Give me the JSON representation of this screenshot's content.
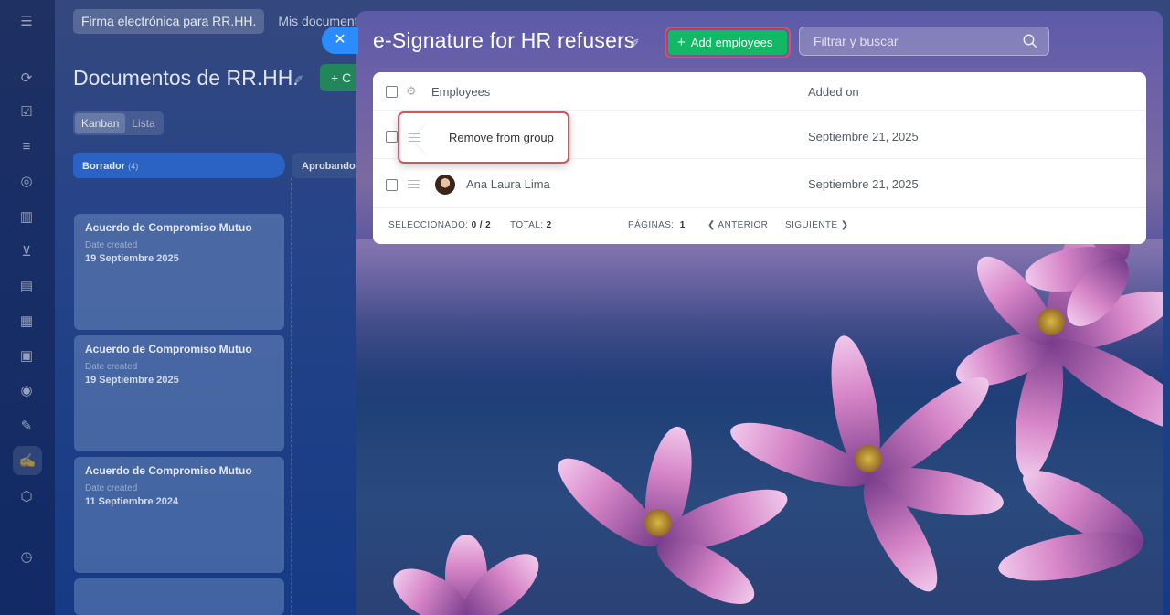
{
  "background": {
    "tabs": [
      "Firma electrónica para RR.HH.",
      "Mis documento"
    ],
    "title": "Documentos de RR.HH.",
    "create_label": "+ C",
    "view_tabs": [
      "Kanban",
      "Lista"
    ],
    "columns": [
      {
        "name": "Borrador",
        "count": "(4)"
      },
      {
        "name": "Aprobando"
      }
    ],
    "cards": [
      {
        "title": "Acuerdo de Compromiso Mutuo",
        "date_label": "Date created",
        "date": "19 Septiembre 2025"
      },
      {
        "title": "Acuerdo de Compromiso Mutuo",
        "date_label": "Date created",
        "date": "19 Septiembre 2025"
      },
      {
        "title": "Acuerdo de Compromiso Mutuo",
        "date_label": "Date created",
        "date": "11 Septiembre 2024"
      }
    ]
  },
  "panel": {
    "close_glyph": "✕",
    "title": "e-Signature for HR refusers",
    "add_button": "Add employees",
    "search_placeholder": "Filtrar y buscar",
    "table": {
      "headers": {
        "employees": "Employees",
        "added_on": "Added on"
      },
      "rows": [
        {
          "name": "",
          "added_on": "Septiembre 21, 2025"
        },
        {
          "name": "Ana Laura Lima",
          "added_on": "Septiembre 21, 2025"
        }
      ],
      "context_menu_item": "Remove from group",
      "footer": {
        "selected_label": "SELECCIONADO:",
        "selected_value": "0 / 2",
        "total_label": "TOTAL:",
        "total_value": "2",
        "pages_label": "PÁGINAS:",
        "pages_value": "1",
        "prev": "ANTERIOR",
        "next": "SIGUIENTE"
      }
    }
  },
  "icons": [
    "menu-icon",
    "settings-gear-icon",
    "search-icon",
    "pin-icon",
    "drag-handle-icon",
    "chevron-left-icon",
    "chevron-right-icon",
    "close-icon"
  ],
  "colors": {
    "accent_green": "#11b965",
    "highlight_red": "#e34f55",
    "close_blue": "#2a8cff"
  }
}
